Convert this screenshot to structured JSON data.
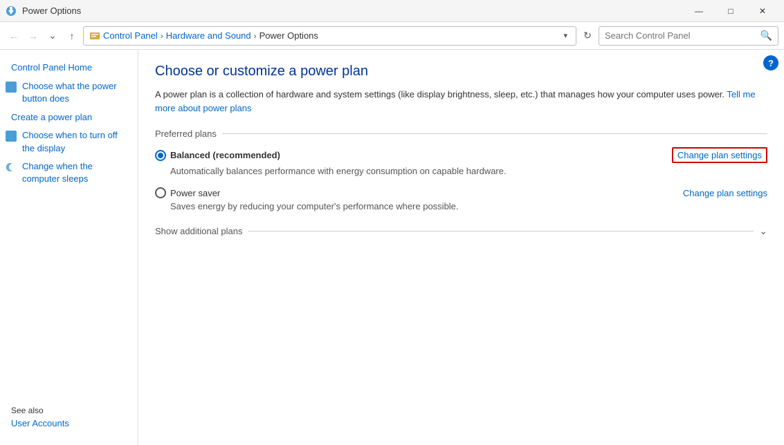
{
  "titleBar": {
    "title": "Power Options",
    "controls": {
      "minimize": "—",
      "maximize": "□",
      "close": "✕"
    }
  },
  "addressBar": {
    "breadcrumbs": [
      {
        "label": "Control Panel",
        "id": "control-panel"
      },
      {
        "label": "Hardware and Sound",
        "id": "hardware-sound"
      },
      {
        "label": "Power Options",
        "id": "power-options"
      }
    ],
    "search": {
      "placeholder": "Search Control Panel",
      "value": ""
    }
  },
  "sidebar": {
    "links": [
      {
        "id": "control-panel-home",
        "label": "Control Panel Home",
        "hasIcon": false
      },
      {
        "id": "power-button",
        "label": "Choose what the power button does",
        "hasIcon": true,
        "iconType": "plug"
      },
      {
        "id": "create-plan",
        "label": "Create a power plan",
        "hasIcon": false
      },
      {
        "id": "turn-off-display",
        "label": "Choose when to turn off the display",
        "hasIcon": true,
        "iconType": "plug"
      },
      {
        "id": "computer-sleeps",
        "label": "Change when the computer sleeps",
        "hasIcon": true,
        "iconType": "moon"
      }
    ],
    "seeAlso": {
      "label": "See also",
      "links": [
        {
          "id": "user-accounts",
          "label": "User Accounts"
        }
      ]
    }
  },
  "content": {
    "title": "Choose or customize a power plan",
    "description": "A power plan is a collection of hardware and system settings (like display brightness, sleep, etc.) that manages how your computer uses power.",
    "descriptionLink": "Tell me more about power plans",
    "preferredPlans": {
      "label": "Preferred plans",
      "plans": [
        {
          "id": "balanced",
          "name": "Balanced (recommended)",
          "description": "Automatically balances performance with energy consumption on capable hardware.",
          "changeSettingsLabel": "Change plan settings",
          "selected": true,
          "highlighted": true
        },
        {
          "id": "power-saver",
          "name": "Power saver",
          "description": "Saves energy by reducing your computer's performance where possible.",
          "changeSettingsLabel": "Change plan settings",
          "selected": false,
          "highlighted": false
        }
      ]
    },
    "additionalPlans": {
      "label": "Show additional plans"
    }
  }
}
